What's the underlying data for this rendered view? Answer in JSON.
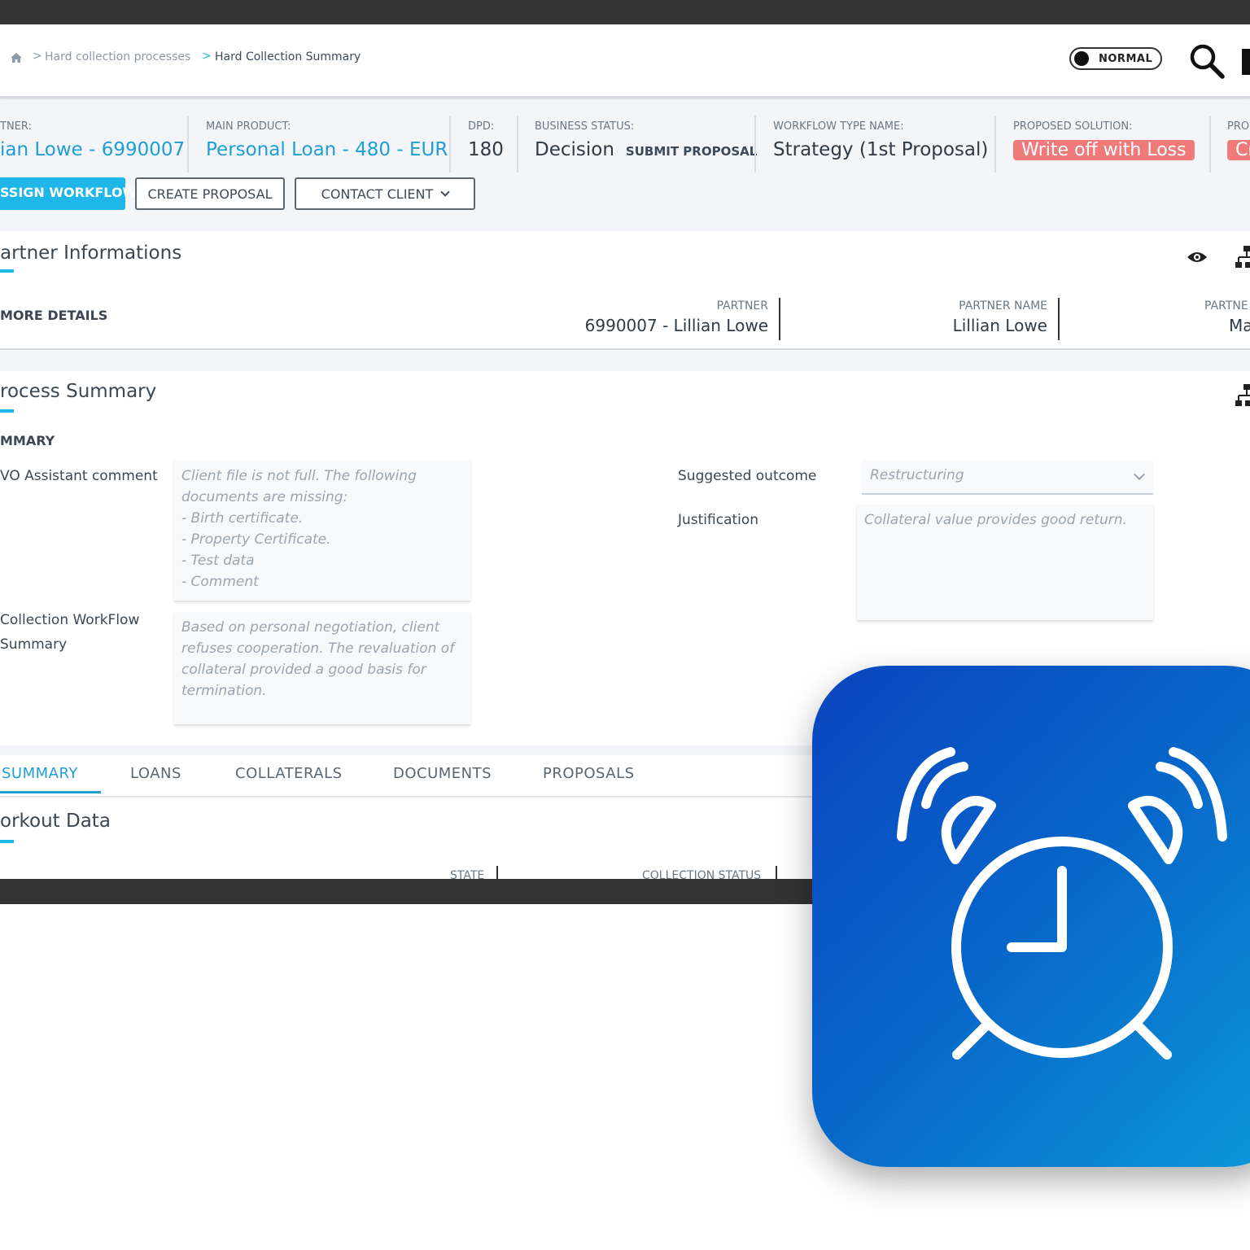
{
  "breadcrumb": {
    "home_icon": "home-icon",
    "items": [
      "Hard collection processes",
      "Hard Collection Summary"
    ],
    "separator": ">"
  },
  "toolbar": {
    "mode_label": "NORMAL",
    "search_icon": "search-icon"
  },
  "header": {
    "partner_label": "TNER:",
    "partner_value": "ian Lowe - 6990007",
    "main_product_label": "MAIN PRODUCT:",
    "main_product_value": "Personal Loan - 480 - EUR",
    "dpd_label": "DPD:",
    "dpd_value": "180",
    "business_status_label": "BUSINESS STATUS:",
    "business_status_value": "Decision",
    "business_status_sub": "SUBMIT PROPOSAL",
    "workflow_type_label": "WORKFLOW TYPE NAME:",
    "workflow_type_value": "Strategy (1st Proposal)",
    "proposed_solution_label": "PROPOSED SOLUTION:",
    "proposed_solution_value": "Write off with Loss",
    "extra_label": "PRO",
    "extra_value": "Cr"
  },
  "actions": {
    "assign_workflow": "SSIGN WORKFLOW",
    "create_proposal": "CREATE PROPOSAL",
    "contact_client": "CONTACT CLIENT"
  },
  "partner_panel": {
    "title": "artner Informations",
    "more_details": "MORE DETAILS",
    "fields": [
      {
        "label": "PARTNER",
        "value": "6990007 - Lillian Lowe"
      },
      {
        "label": "PARTNER NAME",
        "value": "Lillian Lowe"
      },
      {
        "label": "PARTNE",
        "value": "Ma"
      }
    ],
    "icons": [
      "eye-icon",
      "hierarchy-icon"
    ]
  },
  "process_panel": {
    "title": "rocess Summary",
    "section": "MMARY",
    "wo_comment_label": "VO Assistant comment",
    "wo_comment_value": "Client file is not full. The following\ndocuments are missing:\n- Birth certificate.\n- Property Certificate.\n- Test data\n- Comment",
    "workflow_summary_label_1": "Collection WorkFlow",
    "workflow_summary_label_2": "Summary",
    "workflow_summary_value": "Based on personal negotiation, client\nrefuses cooperation. The revaluation of\ncollateral provided a good basis for\ntermination.",
    "suggested_outcome_label": "Suggested outcome",
    "suggested_outcome_value": "Restructuring",
    "justification_label": "Justification",
    "justification_value": "Collateral value provides good return."
  },
  "tabs": [
    "SUMMARY",
    "LOANS",
    "COLLATERALS",
    "DOCUMENTS",
    "PROPOSALS"
  ],
  "workout": {
    "title": "orkout Data",
    "columns": [
      "STATE",
      "COLLECTION STATUS"
    ]
  },
  "app_icon": {
    "name": "alarm-clock-icon",
    "gradient_start": "#0b44be",
    "gradient_end": "#0c9ad9"
  },
  "colors": {
    "accent": "#1fb6e8",
    "link": "#1f9ed6",
    "danger_badge": "#f07a7a",
    "bezel": "#333333"
  }
}
